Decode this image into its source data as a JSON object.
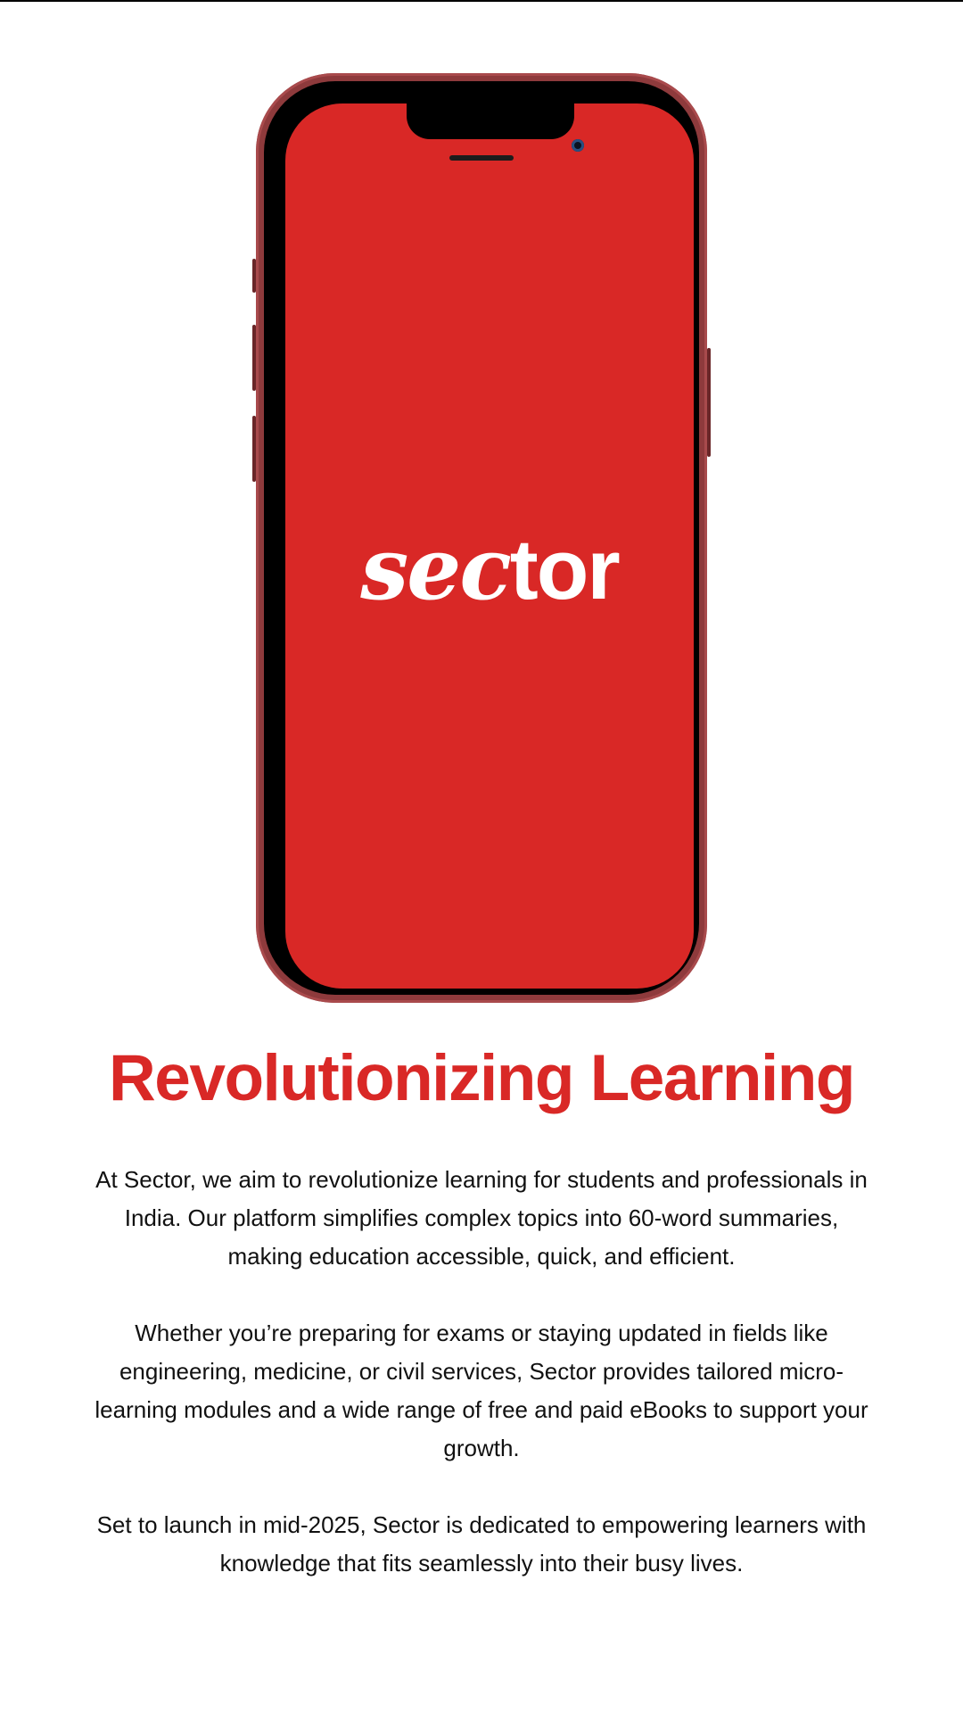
{
  "phone": {
    "logo_prefix": "sec",
    "logo_suffix": "tor",
    "screen_color": "#d92826"
  },
  "heading": "Revolutionizing Learning",
  "paragraphs": [
    "At Sector, we aim to revolutionize learning for students and professionals in India. Our platform simplifies complex topics into 60-word summaries, making education accessible, quick, and efficient.",
    "Whether you’re preparing for exams or staying updated in fields like engineering, medicine, or civil services, Sector provides tailored micro-learning modules and a wide range of free and paid eBooks to support your growth.",
    "Set to launch in mid-2025, Sector is dedicated to empowering learners with knowledge that fits seamlessly into their busy lives."
  ]
}
